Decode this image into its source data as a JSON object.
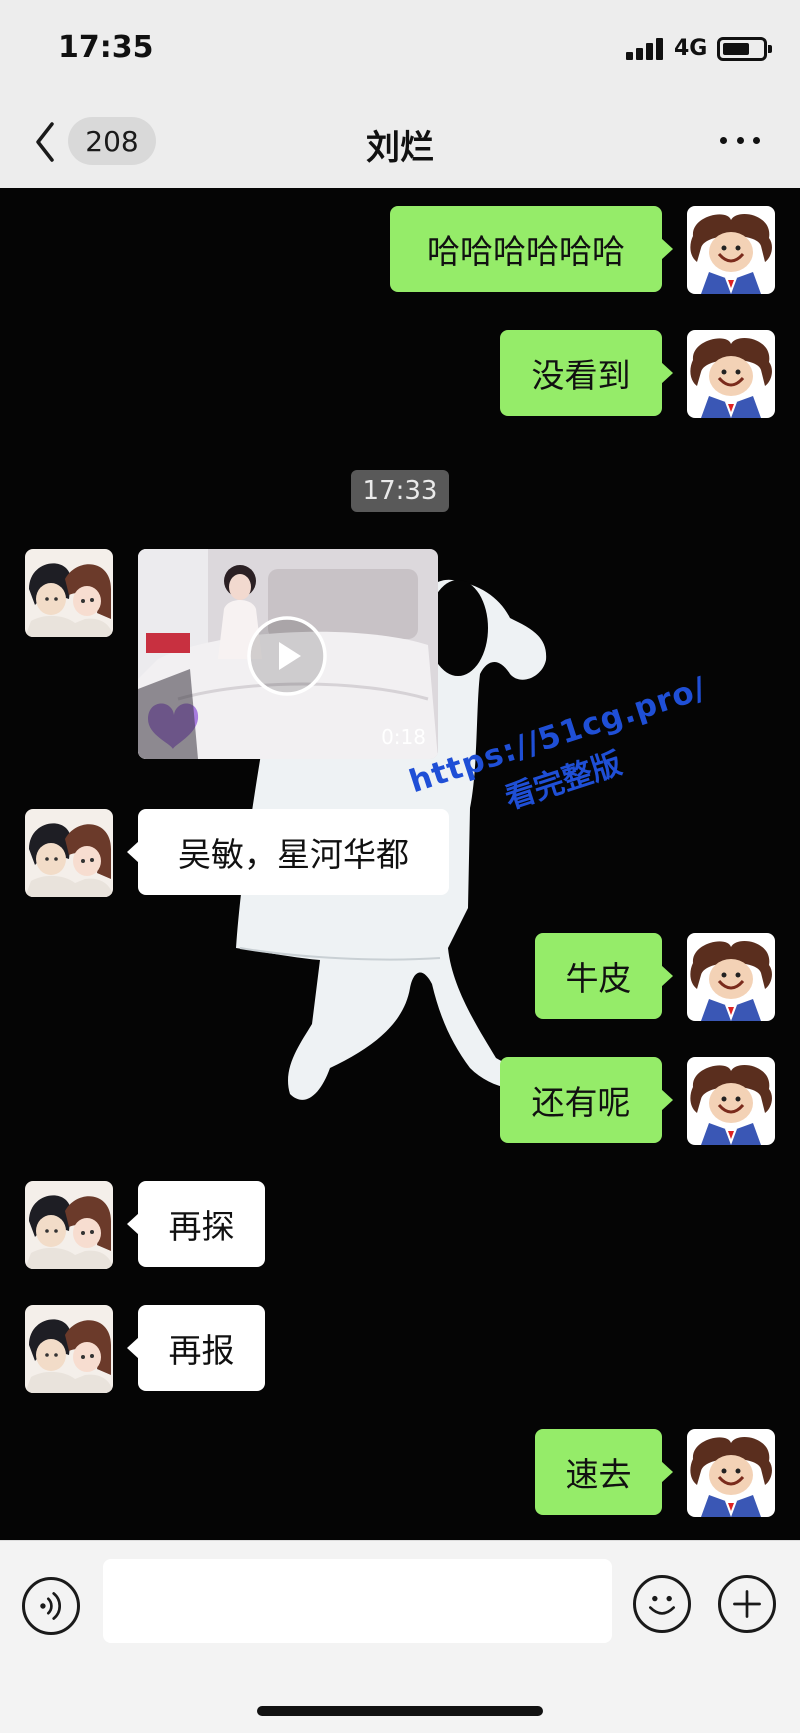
{
  "status_bar": {
    "time": "17:35",
    "network": "4G"
  },
  "header": {
    "unread_count": "208",
    "title": "刘烂"
  },
  "chat": {
    "timestamp": "17:33",
    "messages": [
      {
        "sender": "me",
        "type": "text",
        "text": "哈哈哈哈哈哈"
      },
      {
        "sender": "me",
        "type": "text",
        "text": "没看到"
      },
      {
        "sender": "them",
        "type": "video",
        "duration": "0:18"
      },
      {
        "sender": "them",
        "type": "text",
        "text": "吴敏，星河华都"
      },
      {
        "sender": "me",
        "type": "text",
        "text": "牛皮"
      },
      {
        "sender": "me",
        "type": "text",
        "text": "还有呢"
      },
      {
        "sender": "them",
        "type": "text",
        "text": "再探"
      },
      {
        "sender": "them",
        "type": "text",
        "text": "再报"
      },
      {
        "sender": "me",
        "type": "text",
        "text": "速去"
      }
    ]
  },
  "watermark": {
    "url": "https://51cg.pro/",
    "caption": "看完整版"
  },
  "input_bar": {
    "placeholder": ""
  },
  "colors": {
    "my_bubble": "#95ec69",
    "their_bubble": "#ffffff",
    "chat_background": "#050505",
    "watermark": "#1f4fd6"
  }
}
